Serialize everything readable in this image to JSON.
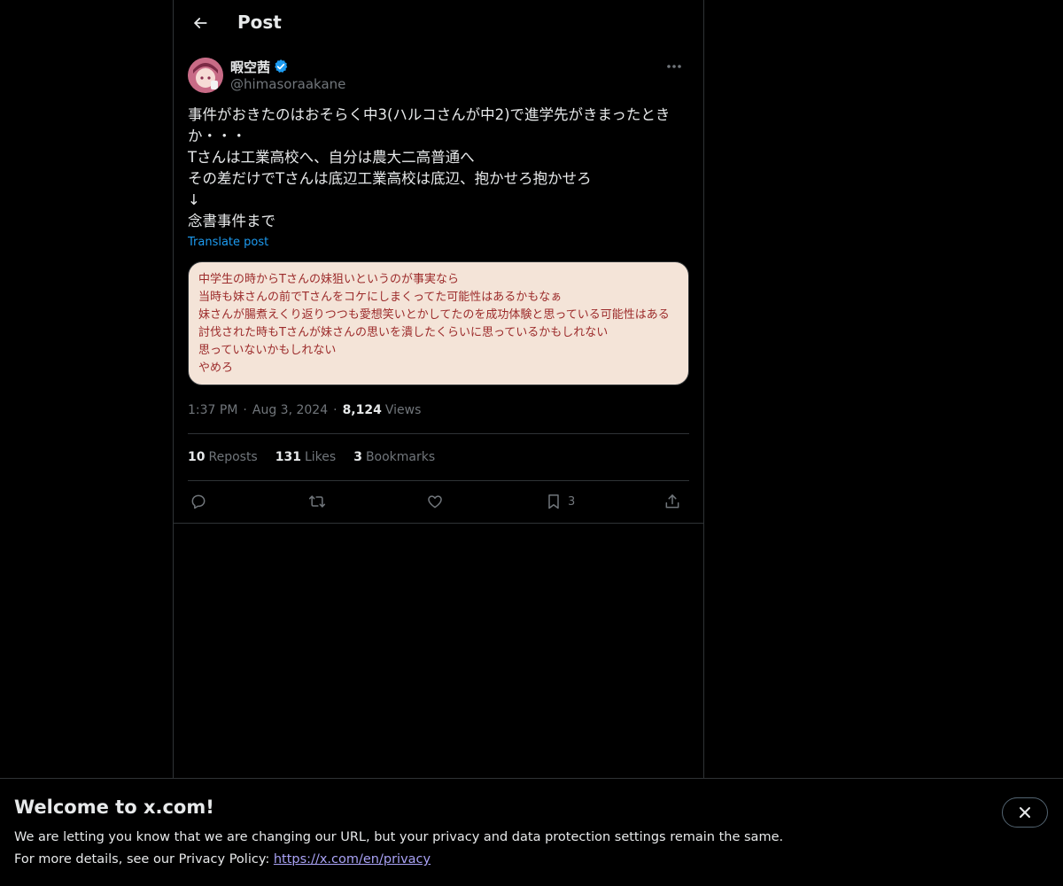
{
  "header": {
    "title": "Post"
  },
  "author": {
    "display_name": "暇空茜",
    "handle": "@himasoraakane",
    "verified": true
  },
  "post": {
    "text": "事件がおきたのはおそらく中3(ハルコさんが中2)で進学先がきまったときか・・・\nTさんは工業高校へ、自分は農大二高普通へ\nその差だけでTさんは底辺工業高校は底辺、抱かせろ抱かせろ\n↓\n念書事件まで",
    "translate_label": "Translate post",
    "image_text": "中学生の時からTさんの妹狙いというのが事実なら\n当時も妹さんの前でTさんをコケにしまくってた可能性はあるかもなぁ\n妹さんが腸煮えくり返りつつも愛想笑いとかしてたのを成功体験と思っている可能性はある\n討伐された時もTさんが妹さんの思いを潰したくらいに思っているかもしれない\n思っていないかもしれない\nやめろ",
    "time": "1:37 PM",
    "date": "Aug 3, 2024",
    "views_count": "8,124",
    "views_label": "Views"
  },
  "stats": {
    "reposts_count": "10",
    "reposts_label": "Reposts",
    "likes_count": "131",
    "likes_label": "Likes",
    "bookmarks_count": "3",
    "bookmarks_label": "Bookmarks"
  },
  "actions": {
    "bookmark_count": "3"
  },
  "banner": {
    "title": "Welcome to x.com!",
    "line1": "We are letting you know that we are changing our URL, but your privacy and data protection settings remain the same.",
    "line2_prefix": "For more details, see our Privacy Policy: ",
    "link_text": "https://x.com/en/privacy"
  },
  "colors": {
    "background": "#000000",
    "text": "#e7e9ea",
    "muted": "#71767b",
    "accent": "#1d9bf0",
    "border": "#2f3336",
    "link": "#a9a2f5"
  },
  "icons": [
    "back-arrow-icon",
    "verified-badge-icon",
    "more-icon",
    "reply-icon",
    "repost-icon",
    "like-icon",
    "bookmark-icon",
    "share-icon",
    "close-icon"
  ]
}
